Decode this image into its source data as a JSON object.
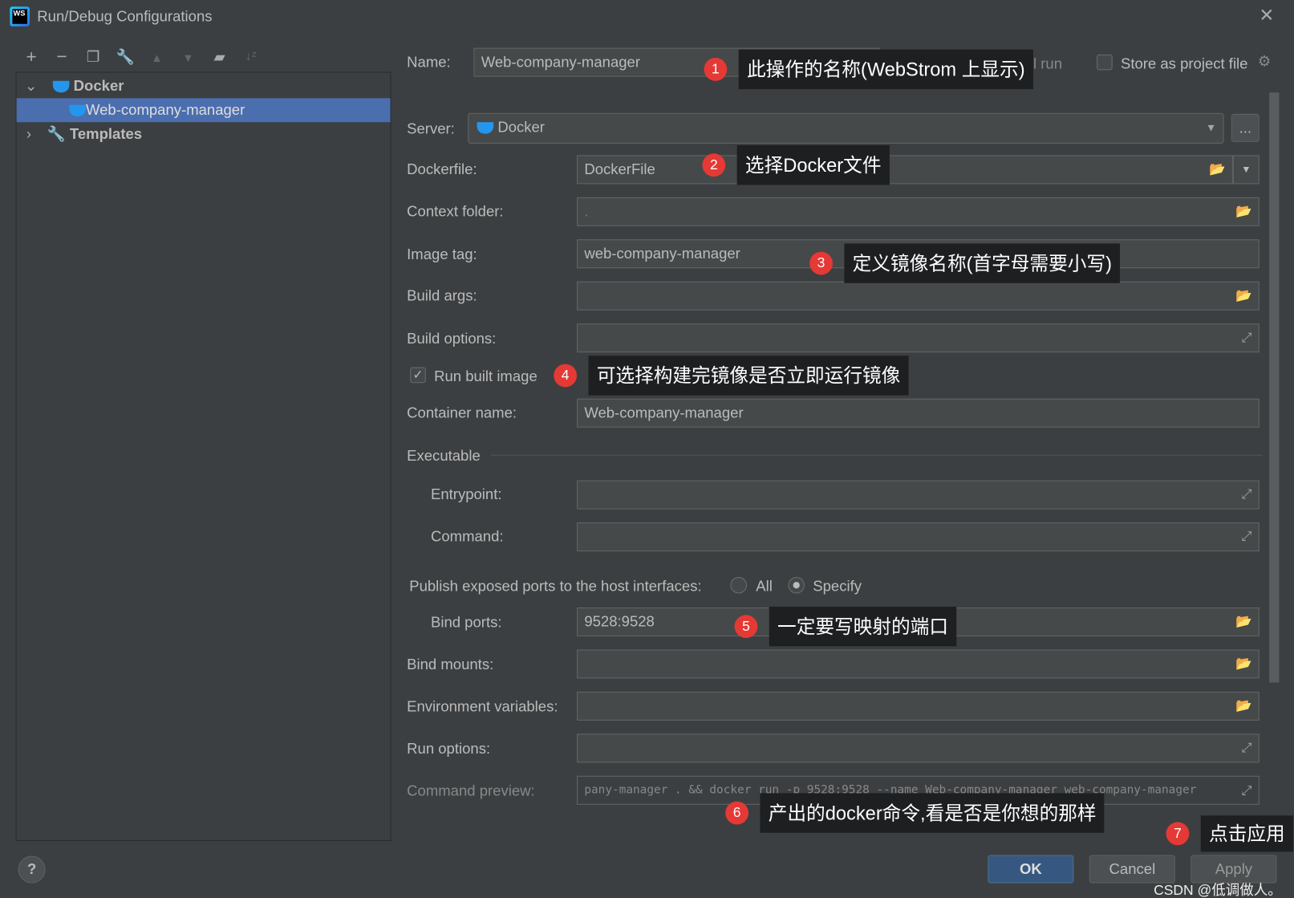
{
  "window": {
    "title": "Run/Debug Configurations",
    "logo_text": "WS"
  },
  "toolbar": {
    "icons": [
      "plus-icon",
      "minus-icon",
      "copy-icon",
      "wrench-icon",
      "arrow-up-icon",
      "arrow-down-icon",
      "new-folder-icon",
      "sort-icon"
    ]
  },
  "tree": {
    "group": "Docker",
    "item": "Web-company-manager",
    "templates": "Templates"
  },
  "form": {
    "name_label": "Name:",
    "name_value": "Web-company-manager",
    "allow_parallel": "Allow parallel run",
    "store_project": "Store as project file",
    "server_label": "Server:",
    "server_value": "Docker",
    "server_more": "...",
    "dockerfile_label": "Dockerfile:",
    "dockerfile_value": "DockerFile",
    "context_label": "Context folder:",
    "context_value": ".",
    "image_tag_label": "Image tag:",
    "image_tag_value": "web-company-manager",
    "build_args_label": "Build args:",
    "build_options_label": "Build options:",
    "run_built_image": "Run built image",
    "run_built_image_checked": true,
    "container_label": "Container name:",
    "container_value": "Web-company-manager",
    "executable": "Executable",
    "entrypoint_label": "Entrypoint:",
    "command_label": "Command:",
    "publish_label": "Publish exposed ports to the host interfaces:",
    "radio_all": "All",
    "radio_specify": "Specify",
    "radio_selected": "Specify",
    "bind_ports_label": "Bind ports:",
    "bind_ports_value": "9528:9528",
    "bind_mounts_label": "Bind mounts:",
    "env_label": "Environment variables:",
    "run_options_label": "Run options:",
    "preview_label": "Command preview:",
    "preview_value": "pany-manager . && docker run -p 9528:9528 --name Web-company-manager web-company-manager"
  },
  "buttons": {
    "ok": "OK",
    "cancel": "Cancel",
    "apply": "Apply",
    "help": "?"
  },
  "annotations": [
    {
      "n": "1",
      "text": "此操作的名称(WebStrom 上显示)"
    },
    {
      "n": "2",
      "text": "选择Docker文件"
    },
    {
      "n": "3",
      "text": "定义镜像名称(首字母需要小写)"
    },
    {
      "n": "4",
      "text": "可选择构建完镜像是否立即运行镜像"
    },
    {
      "n": "5",
      "text": "一定要写映射的端口"
    },
    {
      "n": "6",
      "text": "产出的docker命令,看是否是你想的那样"
    },
    {
      "n": "7",
      "text": "点击应用"
    }
  ],
  "watermark": "CSDN @低调做人。",
  "colors": {
    "background": "#3c3f41",
    "selection": "#4b6eaf",
    "ok_button": "#365880",
    "badge": "#e53935"
  }
}
